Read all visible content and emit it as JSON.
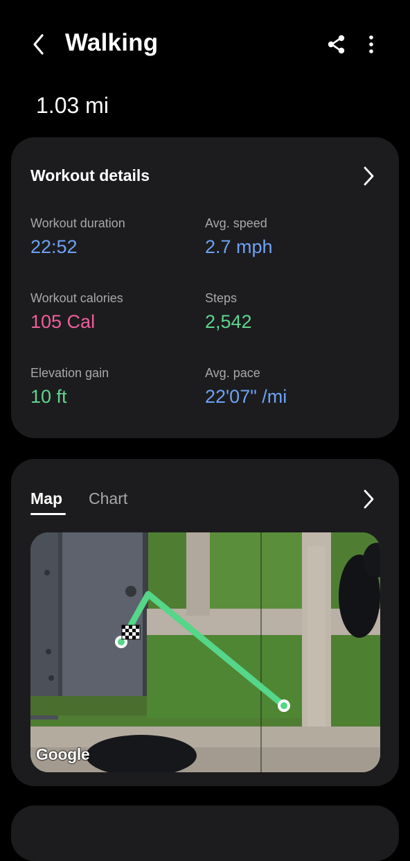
{
  "header": {
    "title": "Walking",
    "distance": "1.03 mi"
  },
  "workout_details": {
    "title": "Workout details",
    "stats": [
      {
        "label": "Workout duration",
        "value": "22:52"
      },
      {
        "label": "Avg. speed",
        "value": "2.7 mph"
      },
      {
        "label": "Workout calories",
        "value": "105 Cal"
      },
      {
        "label": "Steps",
        "value": "2,542"
      },
      {
        "label": "Elevation gain",
        "value": "10 ft"
      },
      {
        "label": "Avg. pace",
        "value": "22'07\" /mi"
      }
    ]
  },
  "map_section": {
    "tabs": [
      {
        "label": "Map"
      },
      {
        "label": "Chart"
      }
    ],
    "attribution": "Google"
  },
  "colors": {
    "background": "#000000",
    "card": "#1c1c1e",
    "duration_speed_pace": "#6ea2f3",
    "calories": "#ee5f9d",
    "steps_elevation": "#5fd48f",
    "route": "#55d688"
  }
}
